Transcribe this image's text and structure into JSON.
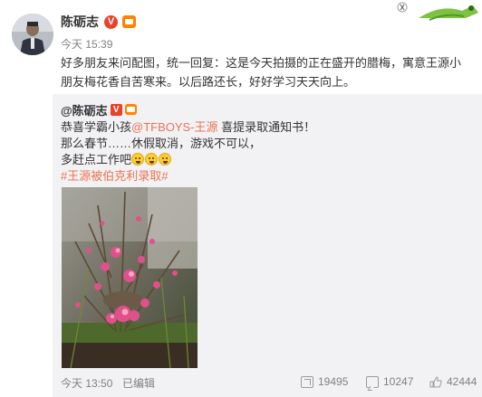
{
  "post": {
    "author": "陈砺志",
    "verified_badge": "V",
    "time": "今天 15:39",
    "text": "好多朋友来问配图，统一回复：这是今天拍摄的正在盛开的腊梅，寓意王源小朋友梅花香自苦寒来。以后路还长，好好学习天天向上。"
  },
  "repost": {
    "author": "@陈砺志",
    "verified_badge": "V",
    "line1_prefix": "恭喜学霸小孩",
    "line1_mention": "@TFBOYS-王源",
    "line1_suffix": " 喜提录取通知书！",
    "line2": "那么春节……休假取消，游戏不可以，",
    "line3": "多赶点工作吧",
    "hashtag": "#王源被伯克利录取#",
    "time": "今天 13:50",
    "edited": "已编辑",
    "shares": "19495",
    "comments": "10247",
    "likes": "42444"
  },
  "colors": {
    "link": "#eb7350",
    "muted": "#808080",
    "repost_bg": "#f2f2f5"
  },
  "icons": [
    "verified-v-icon",
    "member-icon",
    "emoji-icon",
    "share-icon",
    "comment-icon",
    "like-icon"
  ]
}
